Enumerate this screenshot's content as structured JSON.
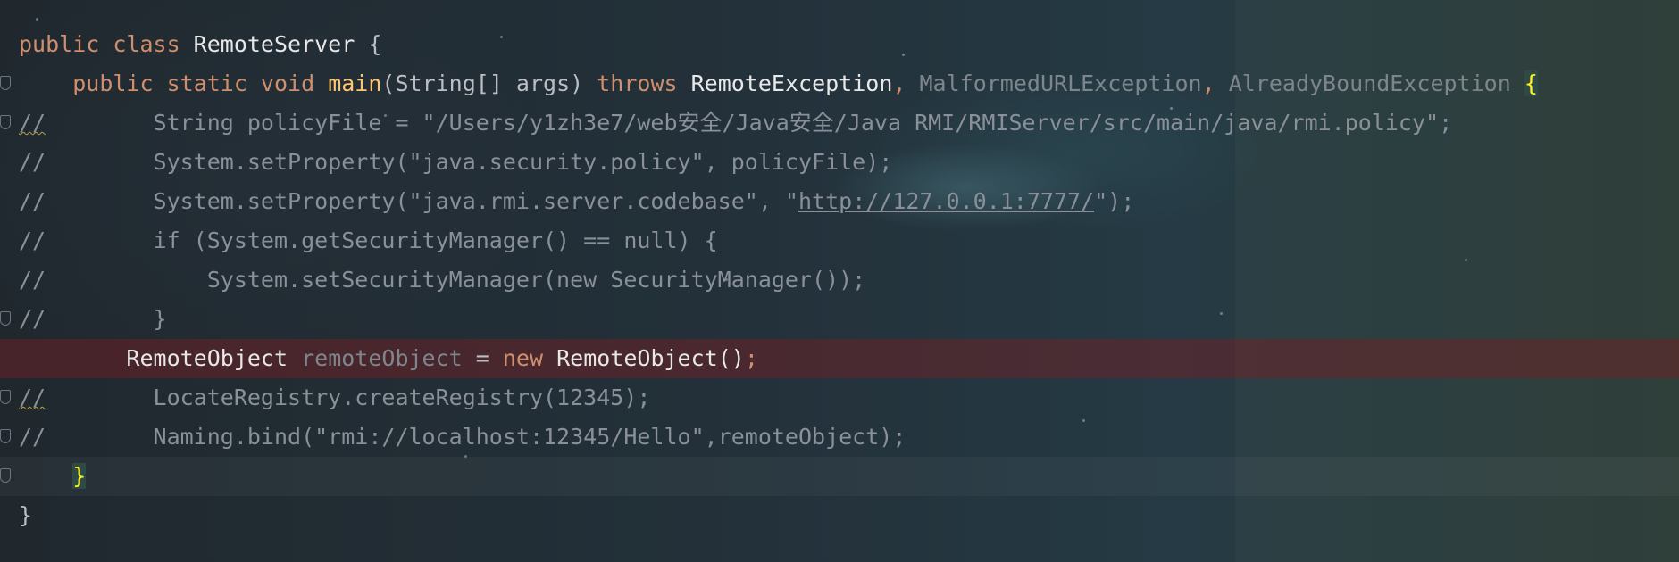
{
  "editor": {
    "lines": [
      {
        "kw1": "public class ",
        "name": "RemoteServer",
        "rest": " {"
      },
      {
        "indent": "    ",
        "kw": "public static void ",
        "fn": "main",
        "args": "(String[] args) ",
        "throws": "throws ",
        "ex1": "RemoteException",
        "sep1": ", ",
        "ex2": "MalformedURLException",
        "sep2": ", ",
        "ex3": "AlreadyBoundException",
        "sp": " ",
        "brace": "{"
      },
      {
        "comment": "//",
        "text": "        String policyFile = \"/Users/y1zh3e7/web安全/Java安全/Java RMI/RMIServer/src/main/java/rmi.policy\";"
      },
      {
        "comment": "//",
        "text": "        System.setProperty(\"java.security.policy\", policyFile);"
      },
      {
        "comment": "//",
        "pre": "        System.setProperty(\"java.rmi.server.codebase\", \"",
        "url": "http://127.0.0.1:7777/",
        "post": "\");"
      },
      {
        "comment": "//",
        "text": "        if (System.getSecurityManager() == null) {"
      },
      {
        "comment": "//",
        "text": "            System.setSecurityManager(new SecurityManager());"
      },
      {
        "comment": "//",
        "text": "        }"
      },
      {
        "indent": "        ",
        "type": "RemoteObject ",
        "var": "remoteObject",
        "eq": " = ",
        "kwnew": "new ",
        "ctor": "RemoteObject()",
        "semi": ";"
      },
      {
        "comment": "//",
        "text": "        LocateRegistry.createRegistry(12345);"
      },
      {
        "comment": "//",
        "text": "        Naming.bind(\"rmi://localhost:12345/Hello\",remoteObject);"
      },
      {
        "indent": "    ",
        "brace": "}"
      },
      {
        "brace": "}"
      }
    ]
  }
}
